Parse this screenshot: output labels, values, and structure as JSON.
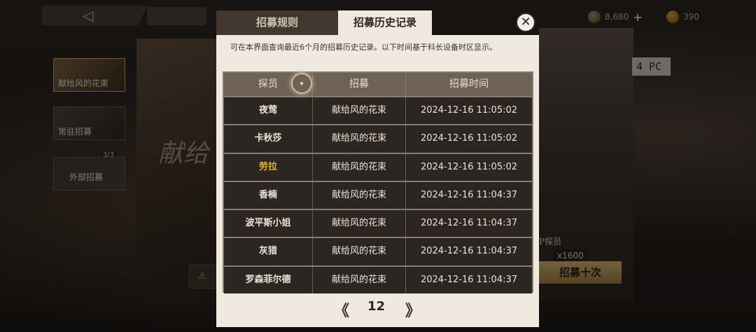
{
  "resources": {
    "currency_1": "8,680",
    "currency_1_plus": "+",
    "currency_2": "390"
  },
  "background": {
    "back_icon": "◁",
    "left_cards": [
      "献给风的花束",
      "常驻招募",
      "外部招募"
    ],
    "slot_count": "3/3",
    "banner_text": "献给",
    "tag": "4 PC",
    "probe_label": "P探员",
    "cost": "x1600",
    "recruit_ten": "招募十次"
  },
  "modal": {
    "tabs": [
      "招募规则",
      "招募历史记录"
    ],
    "active_tab": 1,
    "close_icon": "✕",
    "description": "可在本界面查询最近6个月的招募历史记录。以下时间基于科长设备时区显示。",
    "headers": [
      "探员",
      "招募",
      "招募时间"
    ],
    "rows": [
      {
        "name": "夜莺",
        "pool": "献给风的花束",
        "time": "2024-12-16 11:05:02"
      },
      {
        "name": "卡秋莎",
        "pool": "献给风的花束",
        "time": "2024-12-16 11:05:02"
      },
      {
        "name": "劳拉",
        "pool": "献给风的花束",
        "time": "2024-12-16 11:05:02"
      },
      {
        "name": "香楠",
        "pool": "献给风的花束",
        "time": "2024-12-16 11:04:37"
      },
      {
        "name": "波平斯小姐",
        "pool": "献给风的花束",
        "time": "2024-12-16 11:04:37"
      },
      {
        "name": "灰猎",
        "pool": "献给风的花束",
        "time": "2024-12-16 11:04:37"
      },
      {
        "name": "罗森菲尔德",
        "pool": "献给风的花束",
        "time": "2024-12-16 11:04:37"
      }
    ],
    "highlight_color": "#e2b93b",
    "pagination": {
      "prev_icon": "《",
      "page": "12",
      "next_icon": "》"
    }
  }
}
